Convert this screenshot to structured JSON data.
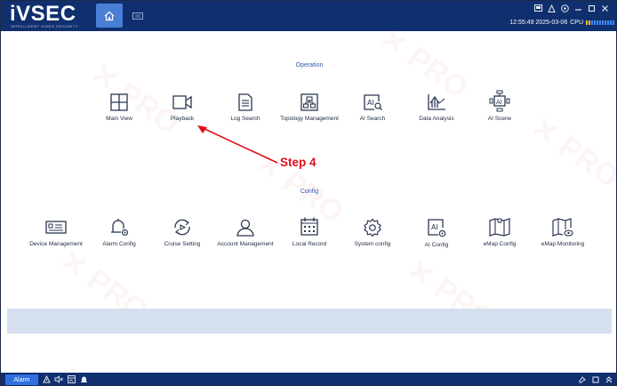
{
  "app": {
    "logo": "iVSEC",
    "logo_subtitle": "INTELLIGENT VIDEO SECURITY"
  },
  "status": {
    "datetime": "12:55:49 2025-03-06",
    "cpu_label": "CPU"
  },
  "sections": {
    "operation_title": "Operation",
    "config_title": "Config"
  },
  "operation_items": [
    {
      "label": "Main View",
      "icon": "grid-window-icon"
    },
    {
      "label": "Playback",
      "icon": "video-camera-icon"
    },
    {
      "label": "Log Search",
      "icon": "document-icon"
    },
    {
      "label": "Topology Management",
      "icon": "topology-icon"
    },
    {
      "label": "AI Search",
      "icon": "ai-search-icon"
    },
    {
      "label": "Data Analysis",
      "icon": "analysis-chart-icon"
    },
    {
      "label": "AI Scene",
      "icon": "ai-scene-icon"
    }
  ],
  "config_items": [
    {
      "label": "Device Management",
      "icon": "recorder-device-icon"
    },
    {
      "label": "Alarm Config",
      "icon": "alarm-bell-gear-icon"
    },
    {
      "label": "Cruise Setting",
      "icon": "cruise-sync-icon"
    },
    {
      "label": "Account Management",
      "icon": "user-account-icon"
    },
    {
      "label": "Local Record",
      "icon": "calendar-record-icon"
    },
    {
      "label": "System config",
      "icon": "settings-gear-icon"
    },
    {
      "label": "AI Config",
      "icon": "ai-config-icon"
    },
    {
      "label": "eMap Config",
      "icon": "map-config-icon"
    },
    {
      "label": "eMap Monitoring",
      "icon": "map-monitoring-icon"
    }
  ],
  "annotation": {
    "step_label": "Step 4",
    "color": "#e0101a"
  },
  "bottom_bar": {
    "alarm_label": "Alarm"
  },
  "colors": {
    "topbar": "#102f6e",
    "active_tab": "#4a7fd6",
    "section_title": "#3355aa",
    "info_bar": "#d5dfee"
  }
}
